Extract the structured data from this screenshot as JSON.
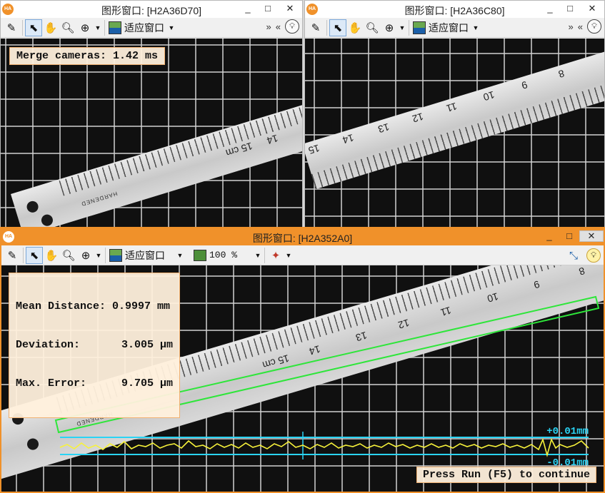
{
  "windows": {
    "top_left": {
      "title": "图形窗口: [H2A36D70]",
      "app_logo": "HA",
      "fit_label": "适应窗口",
      "overlay": "Merge cameras: 1.42 ms",
      "ruler_numbers": [
        "14",
        "15 cm"
      ],
      "ruler_stamp": "HARDENED"
    },
    "top_right": {
      "title": "图形窗口: [H2A36C80]",
      "app_logo": "HA",
      "fit_label": "适应窗口",
      "ruler_numbers": [
        "8",
        "9",
        "10",
        "11",
        "12",
        "13",
        "14",
        "15"
      ]
    },
    "bottom": {
      "title": "图形窗口: [H2A352A0]",
      "app_logo": "HA",
      "fit_label": "适应窗口",
      "zoom_value": "100 %",
      "results": [
        {
          "label": "Mean Distance:",
          "value": "0.9997 mm"
        },
        {
          "label": "Deviation:",
          "value": "3.005 µm"
        },
        {
          "label": "Max. Error:",
          "value": "9.705 µm"
        }
      ],
      "ruler_numbers": [
        "8",
        "9",
        "10",
        "11",
        "12",
        "13",
        "14",
        "15 cm"
      ],
      "ruler_stamp": "HARDENED",
      "upper_limit": "+0.01mm",
      "lower_limit": "-0.01mm",
      "hint": "Press Run (F5) to continue"
    }
  },
  "window_buttons": {
    "minimize": "_",
    "maximize": "□",
    "close": "✕"
  },
  "toolbar_glyphs": {
    "chevron": "»",
    "back": "«",
    "caret": "▼"
  },
  "colors": {
    "accent": "#f0912a",
    "measure_box": "#2ee63a",
    "limit_lines": "#2ad4f5",
    "deviation_curve": "#f7f23a",
    "overlay_bg": "#fff0dc"
  },
  "icons": [
    "edit-icon",
    "pointer-icon",
    "hand-icon",
    "zoom-icon",
    "zoom-plus-icon",
    "fit-window-icon",
    "zoom-percent-icon",
    "color-picker-icon",
    "axes-icon",
    "lightbulb-icon"
  ]
}
